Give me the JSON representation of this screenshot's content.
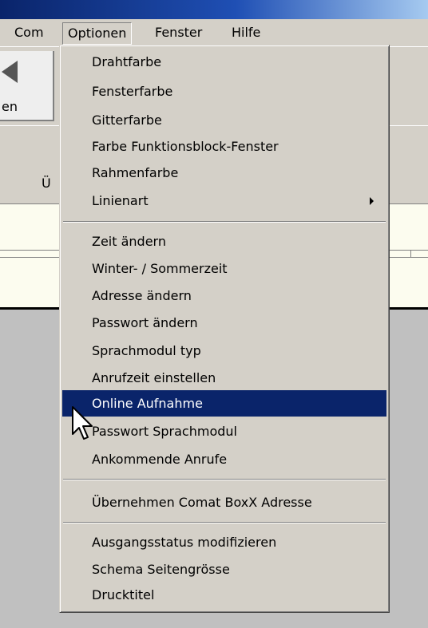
{
  "menubar": {
    "items": [
      "Com",
      "Optionen",
      "Fenster",
      "Hilfe"
    ],
    "open_item": "Optionen"
  },
  "background": {
    "toolbar_button_label": "en",
    "panel_label": "Ü"
  },
  "menu": {
    "groups": [
      [
        "Drahtfarbe",
        "Fensterfarbe",
        "Gitterfarbe",
        "Farbe Funktionsblock-Fenster",
        "Rahmenfarbe",
        "Linienart"
      ],
      [
        "Zeit ändern",
        "Winter- / Sommerzeit",
        "Adresse ändern",
        "Passwort ändern",
        "Sprachmodul typ",
        "Anrufzeit einstellen",
        "Online Aufnahme",
        "Passwort Sprachmodul",
        "Ankommende Anrufe"
      ],
      [
        "Übernehmen Comat BoxX Adresse"
      ],
      [
        "Ausgangsstatus modifizieren",
        "Schema Seitengrösse",
        "Drucktitel"
      ]
    ],
    "highlighted_item": "Online Aufnahme",
    "submenu_item": "Linienart"
  },
  "colors": {
    "highlight": "#0a246a",
    "menu_background": "#d4d0c8",
    "field_background": "#fcfcef"
  },
  "icons": {
    "cursor": "arrow-pointer-icon",
    "submenu": "submenu-arrow-icon",
    "toolbar": "tool-triangle-icon"
  }
}
